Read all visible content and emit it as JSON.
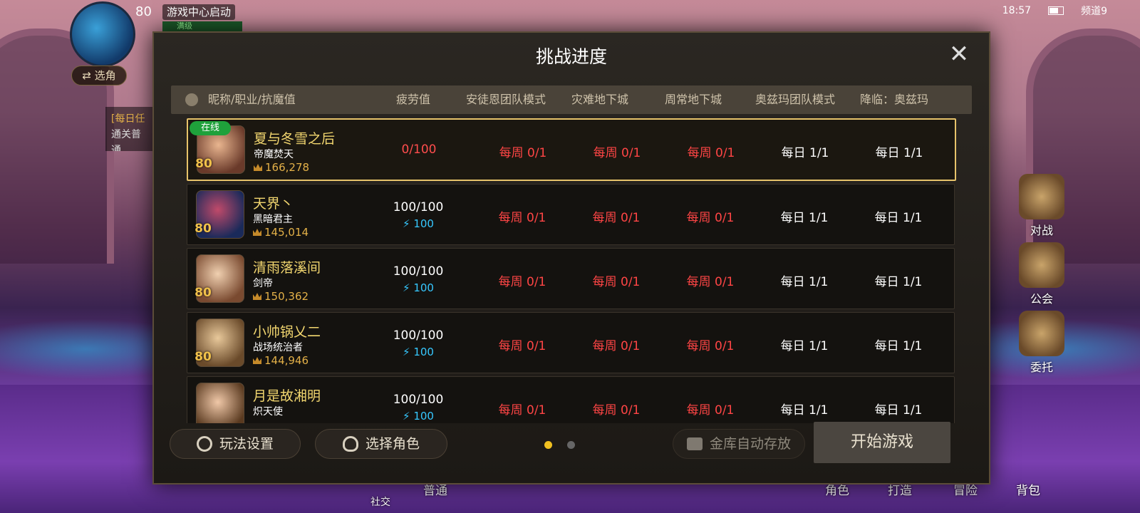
{
  "hud": {
    "level": "80",
    "game_center": "游戏中心启动",
    "full_level": "满级",
    "switch_role": "⇄ 选角",
    "task_title": "[每日任",
    "task_desc": "通关普通"
  },
  "status_bar": {
    "time": "18:57",
    "channel": "频道9"
  },
  "side_menu": [
    {
      "label": "对战",
      "icon": "crossed-swords-icon"
    },
    {
      "label": "公会",
      "icon": "guild-shield-icon"
    },
    {
      "label": "委托",
      "icon": "bulletin-board-icon"
    }
  ],
  "bottom_nav": [
    {
      "label": "社交"
    },
    {
      "label": "普通"
    },
    {
      "label": "角色"
    },
    {
      "label": "打造"
    },
    {
      "label": "冒险"
    },
    {
      "label": "背包"
    }
  ],
  "dialog": {
    "title": "挑战进度",
    "columns": [
      "昵称/职业/抗魔值",
      "疲劳值",
      "安徒恩团队模式",
      "灾难地下城",
      "周常地下城",
      "奥兹玛团队模式",
      "降临：奥兹玛"
    ],
    "rows": [
      {
        "online": "在线",
        "level": "80",
        "name": "夏与冬雪之后",
        "job": "帝魔焚天",
        "power": "166,278",
        "fatigue": "0/100",
        "fatigue_sub": "",
        "c1": "每周 0/1",
        "c2": "每周 0/1",
        "c3": "每周 0/1",
        "c4": "每日 1/1",
        "c5": "每日 1/1"
      },
      {
        "online": "",
        "level": "80",
        "name": "天界丶",
        "job": "黑暗君主",
        "power": "145,014",
        "fatigue": "100/100",
        "fatigue_sub": "100",
        "c1": "每周 0/1",
        "c2": "每周 0/1",
        "c3": "每周 0/1",
        "c4": "每日 1/1",
        "c5": "每日 1/1"
      },
      {
        "online": "",
        "level": "80",
        "name": "清雨落溪间",
        "job": "剑帝",
        "power": "150,362",
        "fatigue": "100/100",
        "fatigue_sub": "100",
        "c1": "每周 0/1",
        "c2": "每周 0/1",
        "c3": "每周 0/1",
        "c4": "每日 1/1",
        "c5": "每日 1/1"
      },
      {
        "online": "",
        "level": "80",
        "name": "小帅锅乂二",
        "job": "战场统治者",
        "power": "144,946",
        "fatigue": "100/100",
        "fatigue_sub": "100",
        "c1": "每周 0/1",
        "c2": "每周 0/1",
        "c3": "每周 0/1",
        "c4": "每日 1/1",
        "c5": "每日 1/1"
      },
      {
        "online": "",
        "level": "",
        "name": "月是故湘明",
        "job": "炽天使",
        "power": "",
        "fatigue": "100/100",
        "fatigue_sub": "100",
        "c1": "每周 0/1",
        "c2": "每周 0/1",
        "c3": "每周 0/1",
        "c4": "每日 1/1",
        "c5": "每日 1/1"
      }
    ],
    "footer": {
      "settings_label": "玩法设置",
      "select_role_label": "选择角色",
      "auto_save_label": "金库自动存放",
      "start_label": "开始游戏",
      "page_indicator": {
        "current": 1,
        "total": 2
      }
    }
  },
  "colors": {
    "accent_gold": "#f2d66f",
    "weekly_red": "#ff4545",
    "fatigue_blue": "#36c8ff",
    "online_green": "#1fa13b"
  }
}
